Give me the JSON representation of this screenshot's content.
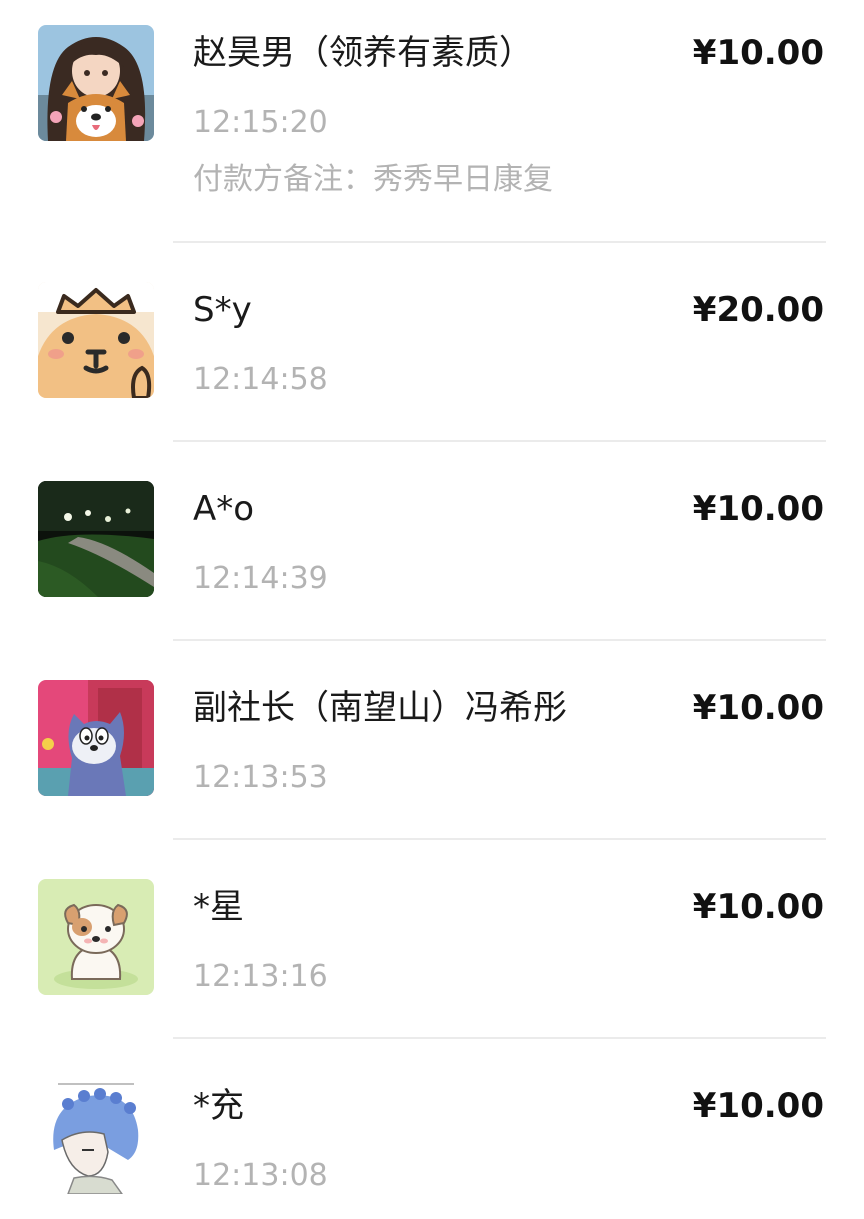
{
  "transactions": [
    {
      "name": "赵昊男（领养有素质）",
      "amount": "¥10.00",
      "time": "12:15:20",
      "note_label": "付款方备注：",
      "note_text": "秀秀早日康复",
      "avatar_icon": "girl-with-corgi-avatar-icon"
    },
    {
      "name": "S*y",
      "amount": "¥20.00",
      "time": "12:14:58",
      "avatar_icon": "crowned-bear-avatar-icon"
    },
    {
      "name": "A*o",
      "amount": "¥10.00",
      "time": "12:14:39",
      "avatar_icon": "night-park-path-avatar-icon"
    },
    {
      "name": "副社长（南望山）冯希彤",
      "amount": "¥10.00",
      "time": "12:13:53",
      "avatar_icon": "cartoon-cat-avatar-icon"
    },
    {
      "name": "*星",
      "amount": "¥10.00",
      "time": "12:13:16",
      "avatar_icon": "puppy-avatar-icon"
    },
    {
      "name": "*充",
      "amount": "¥10.00",
      "time": "12:13:08",
      "avatar_icon": "blue-hair-flower-crown-avatar-icon"
    }
  ],
  "colors": {
    "name_text": "#1a1a1a",
    "amount_text": "#111111",
    "secondary_text": "#b3b3b3",
    "divider": "#ebebeb",
    "background": "#ffffff"
  }
}
